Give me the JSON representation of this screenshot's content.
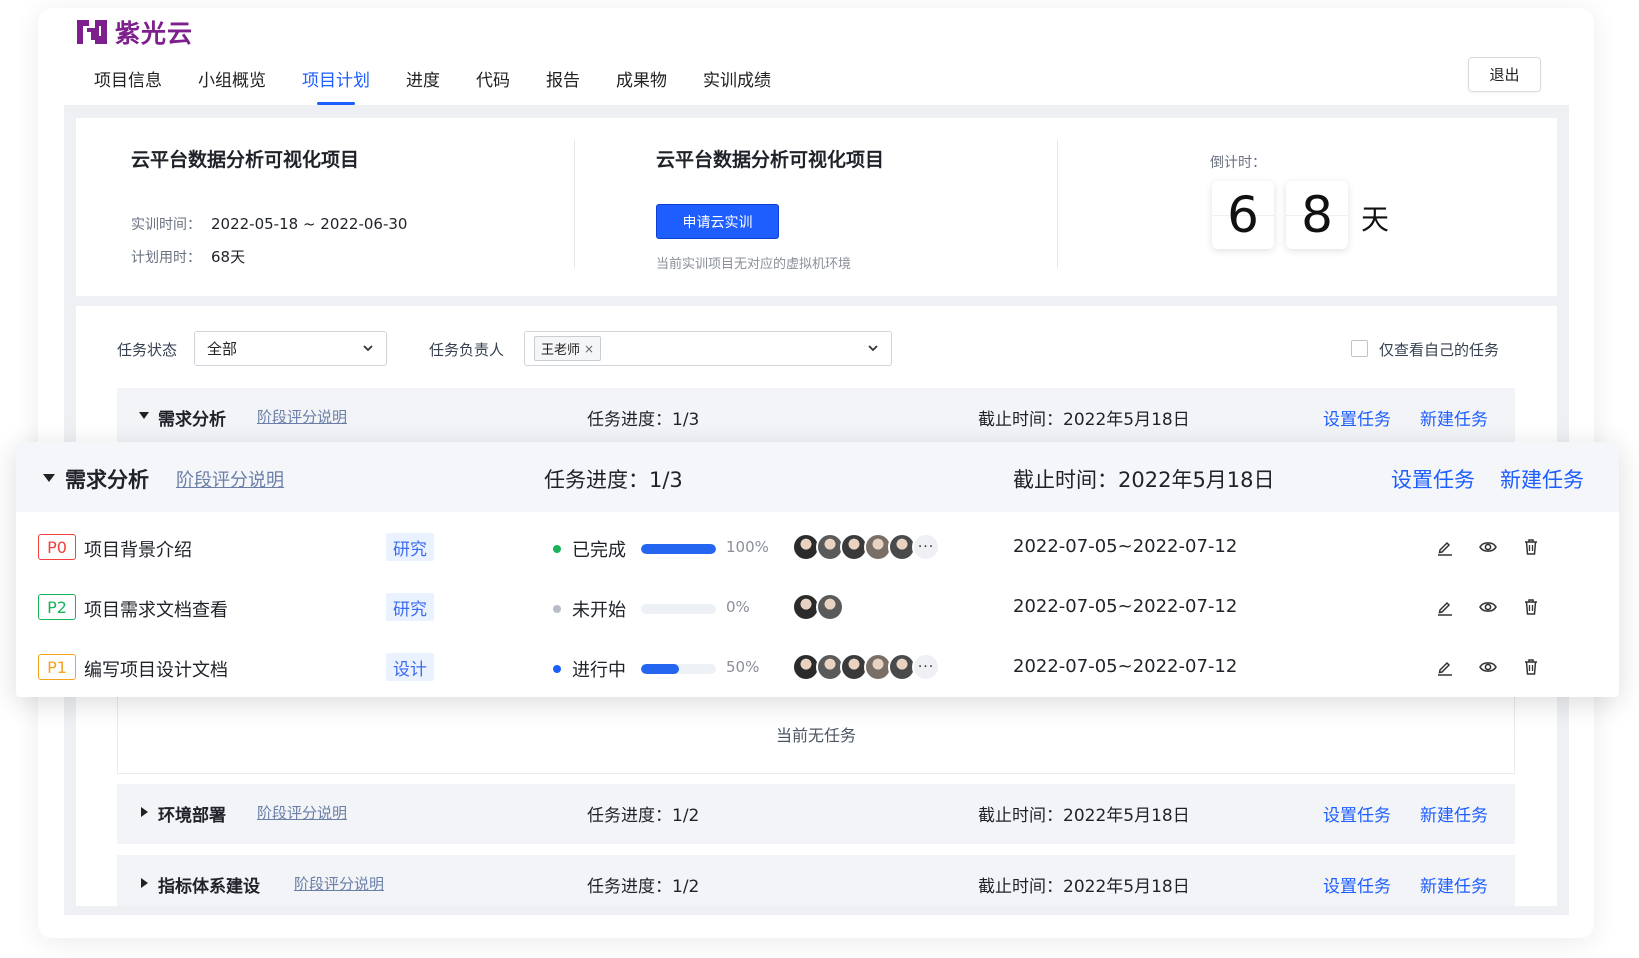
{
  "brand": {
    "name": "紫光云",
    "color": "#7d1f8c"
  },
  "nav": {
    "tabs": [
      "项目信息",
      "小组概览",
      "项目计划",
      "进度",
      "代码",
      "报告",
      "成果物",
      "实训成绩"
    ],
    "active_index": 2,
    "logout_label": "退出"
  },
  "project": {
    "title_left": "云平台数据分析可视化项目",
    "time_label": "实训时间：",
    "time_value": "2022-05-18 ~ 2022-06-30",
    "plan_label": "计划用时：",
    "plan_value": "68天",
    "title_center": "云平台数据分析可视化项目",
    "apply_button": "申请云实训",
    "apply_hint": "当前实训项目无对应的虚拟机环境",
    "countdown_label": "倒计时：",
    "countdown_digits": [
      "6",
      "8"
    ],
    "countdown_unit": "天"
  },
  "filters": {
    "status_label": "任务状态",
    "status_value": "全部",
    "owner_label": "任务负责人",
    "owner_tag": "王老师",
    "owner_tag_close": "×",
    "only_mine_label": "仅查看自己的任务",
    "only_mine_checked": false
  },
  "sections": [
    {
      "name": "需求分析",
      "link": "阶段评分说明",
      "progress": "任务进度：1/3",
      "deadline": "截止时间：2022年5月18日",
      "set_task": "设置任务",
      "new_task": "新建任务",
      "expanded": true
    },
    {
      "name": "环境部署",
      "link": "阶段评分说明",
      "progress": "任务进度：1/2",
      "deadline": "截止时间：2022年5月18日",
      "set_task": "设置任务",
      "new_task": "新建任务",
      "expanded": false
    },
    {
      "name": "指标体系建设",
      "link": "阶段评分说明",
      "progress": "任务进度：1/2",
      "deadline": "截止时间：2022年5月18日",
      "set_task": "设置任务",
      "new_task": "新建任务",
      "expanded": false
    }
  ],
  "empty_text": "当前无任务",
  "popup": {
    "name": "需求分析",
    "link": "阶段评分说明",
    "progress": "任务进度：1/3",
    "deadline": "截止时间：2022年5月18日",
    "set_task": "设置任务",
    "new_task": "新建任务",
    "tasks": [
      {
        "priority": "P0",
        "priority_color": "#f0413c",
        "name": "项目背景介绍",
        "type": "研究",
        "status": "已完成",
        "status_color": "#19b35a",
        "progress": 1.0,
        "percent": "100%",
        "avatar_count": 5,
        "has_more": true,
        "more": "···",
        "date": "2022-07-05~2022-07-12"
      },
      {
        "priority": "P2",
        "priority_color": "#19b35a",
        "name": "项目需求文档查看",
        "type": "研究",
        "status": "未开始",
        "status_color": "#b8bcc4",
        "progress": 0.0,
        "percent": "0%",
        "avatar_count": 2,
        "has_more": false,
        "more": "",
        "date": "2022-07-05~2022-07-12"
      },
      {
        "priority": "P1",
        "priority_color": "#f5a31a",
        "name": "编写项目设计文档",
        "type": "设计",
        "status": "进行中",
        "status_color": "#1e5eff",
        "progress": 0.5,
        "percent": "50%",
        "avatar_count": 5,
        "has_more": true,
        "more": "···",
        "date": "2022-07-05~2022-07-12"
      }
    ]
  },
  "icons": {
    "edit": "edit-icon",
    "view": "eye-icon",
    "delete": "trash-icon",
    "dropdown": "chevron-down-icon"
  },
  "accent": "#1e5eff"
}
